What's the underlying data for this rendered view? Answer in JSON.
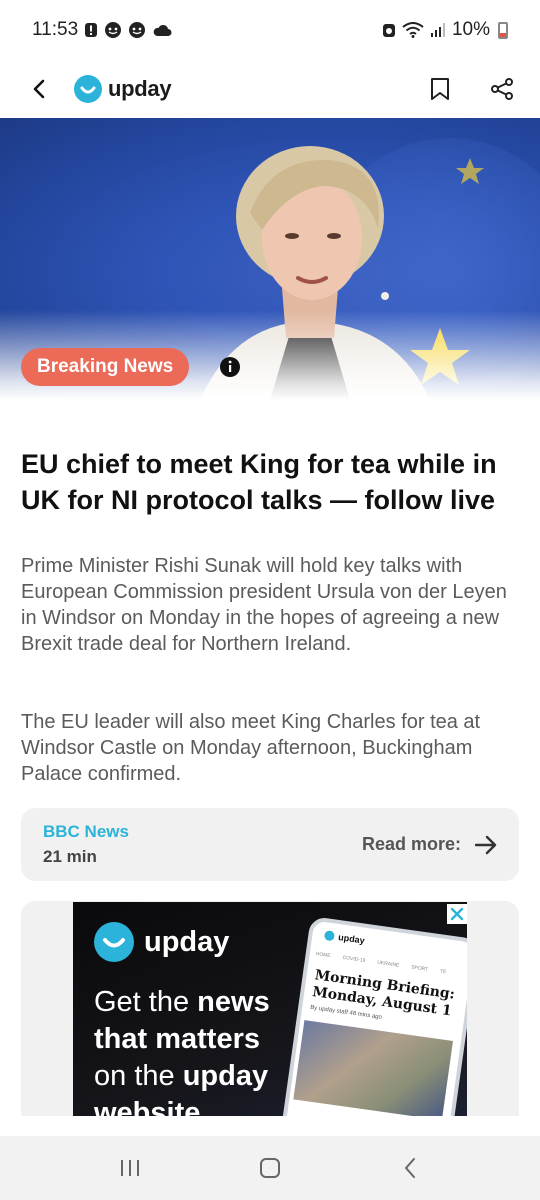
{
  "status_bar": {
    "time": "11:53",
    "battery": "10%"
  },
  "app_bar": {
    "logo_text": "upday"
  },
  "hero": {
    "badge": "Breaking News"
  },
  "article": {
    "headline": "EU chief to meet King for tea while in UK for NI protocol talks — follow live",
    "paragraphs": [
      "Prime Minister Rishi Sunak will hold key talks with European Commission president Ursula von der Leyen in Windsor on Monday in the hopes of agreeing a new Brexit trade deal for Northern Ireland.",
      "The EU leader will also meet King Charles for tea at Windsor Castle on Monday afternoon, Buckingham Palace confirmed."
    ]
  },
  "source": {
    "name": "BBC News",
    "time": "21 min",
    "read_more": "Read more:"
  },
  "ad": {
    "logo_text": "upday",
    "tagline_1": "Get the ",
    "tagline_bold_1": "news",
    "tagline_2": "that matters",
    "tagline_3": "on the ",
    "tagline_bold_2": "upday",
    "tagline_4": "website",
    "phone_logo": "upday",
    "phone_tabs": [
      "HOME",
      "COVID-19",
      "UKRAINE",
      "SPORT",
      "TE"
    ],
    "phone_title": "Morning Briefing: Monday, August 1",
    "phone_byline": "By upday staff   48 mins ago"
  },
  "colors": {
    "accent": "#2bb3d9",
    "badge": "#ec6a58"
  }
}
